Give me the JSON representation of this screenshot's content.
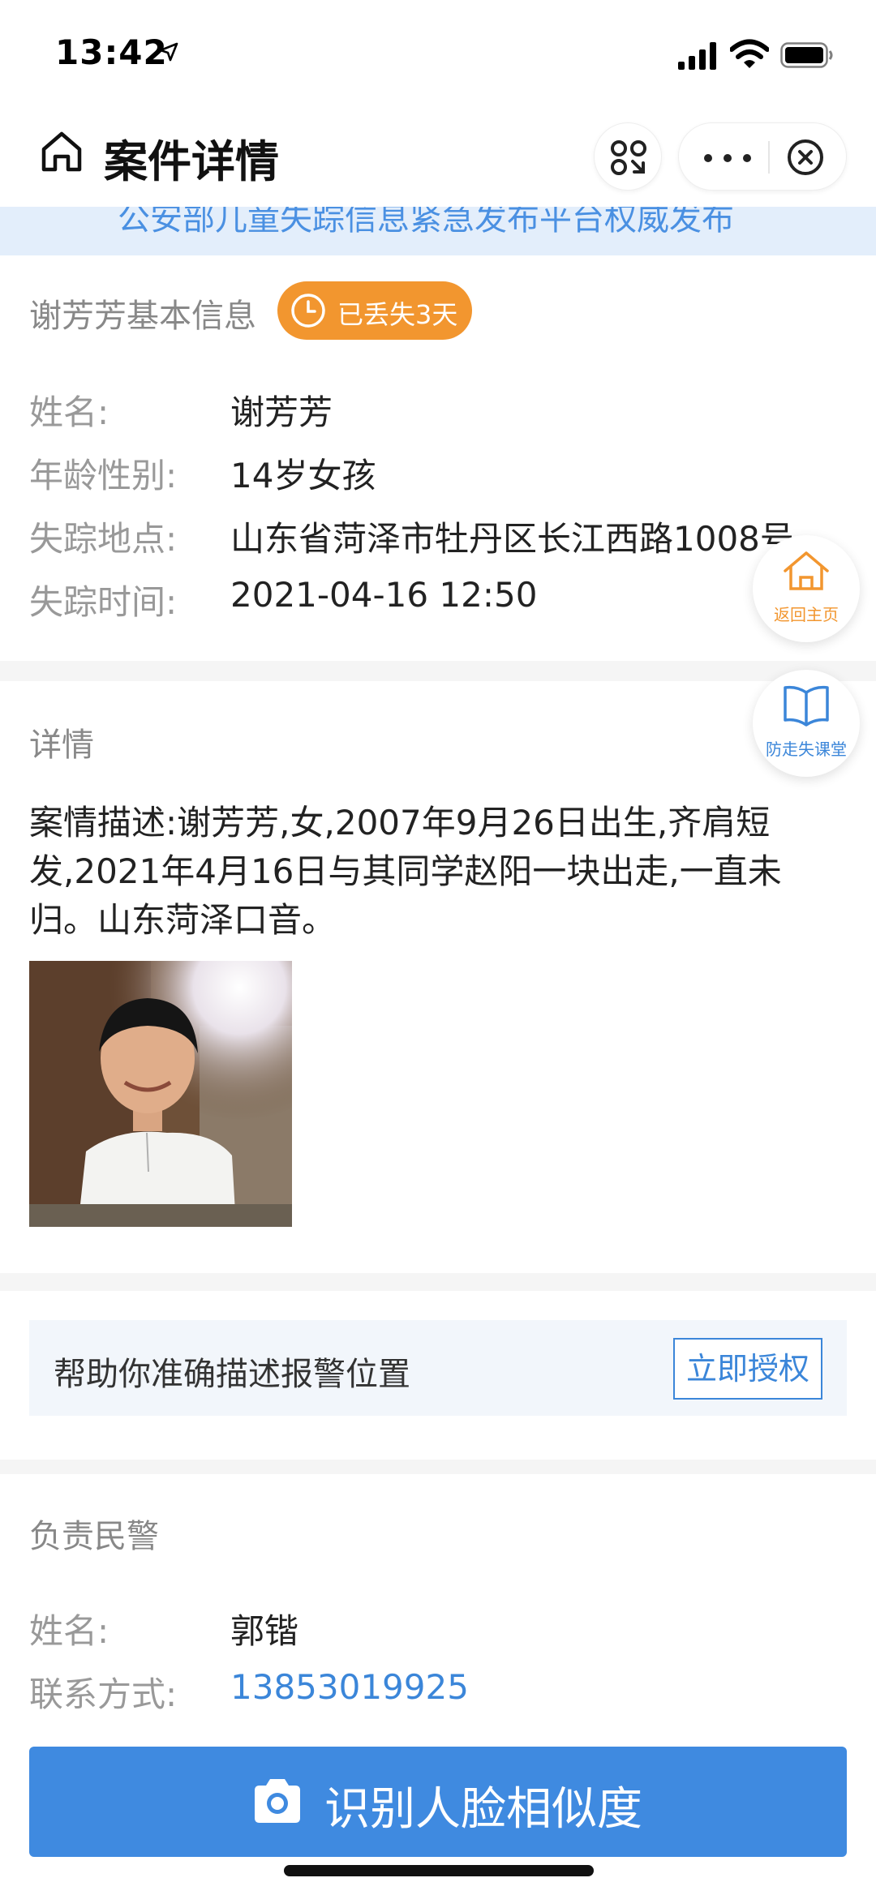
{
  "status_bar": {
    "time": "13:42"
  },
  "nav": {
    "title": "案件详情"
  },
  "banner": {
    "text": "公安部儿童失踪信息紧急发布平台权威发布"
  },
  "basic_info": {
    "title": "谢芳芳基本信息",
    "badge": "已丢失3天",
    "rows": [
      {
        "label": "姓名:",
        "value": "谢芳芳"
      },
      {
        "label": "年龄性别:",
        "value": "14岁女孩"
      },
      {
        "label": "失踪地点:",
        "value": "山东省菏泽市牡丹区长江西路1008号"
      },
      {
        "label": "失踪时间:",
        "value": "2021-04-16 12:50"
      }
    ]
  },
  "detail": {
    "title": "详情",
    "description": "案情描述:谢芳芳,女,2007年9月26日出生,齐肩短发,2021年4月16日与其同学赵阳一块出走,一直未归。山东菏泽口音。"
  },
  "auth": {
    "text": "帮助你准确描述报警位置",
    "button": "立即授权"
  },
  "police": {
    "title": "负责民警",
    "rows": [
      {
        "label": "姓名:",
        "value": "郭锴"
      },
      {
        "label": "联系方式:",
        "value": "13853019925"
      }
    ]
  },
  "face_button": {
    "label": "识别人脸相似度"
  },
  "floats": {
    "home": "返回主页",
    "class": "防走失课堂"
  },
  "colors": {
    "accent": "#3f8ae0",
    "badge": "#f2962f",
    "link": "#3b86d9",
    "float_home": "#f2962f",
    "float_class": "#3b86d9"
  }
}
